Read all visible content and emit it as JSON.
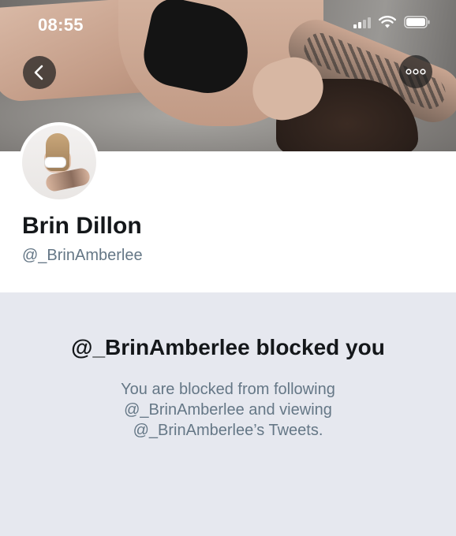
{
  "status_bar": {
    "time": "08:55",
    "signal_icon": "signal-icon",
    "wifi_icon": "wifi-icon",
    "battery_icon": "battery-icon"
  },
  "nav": {
    "back_icon": "chevron-left-icon",
    "more_icon": "more-horizontal-icon"
  },
  "profile": {
    "display_name": "Brin Dillon",
    "handle": "@_BrinAmberlee"
  },
  "blocked": {
    "title": "@_BrinAmberlee blocked you",
    "description_lines": [
      "You are blocked from following",
      "@_BrinAmberlee and viewing",
      "@_BrinAmberlee’s Tweets."
    ]
  },
  "colors": {
    "blocked_panel_bg": "#e6e8ef",
    "secondary_text": "#657786",
    "primary_text": "#14171a"
  }
}
